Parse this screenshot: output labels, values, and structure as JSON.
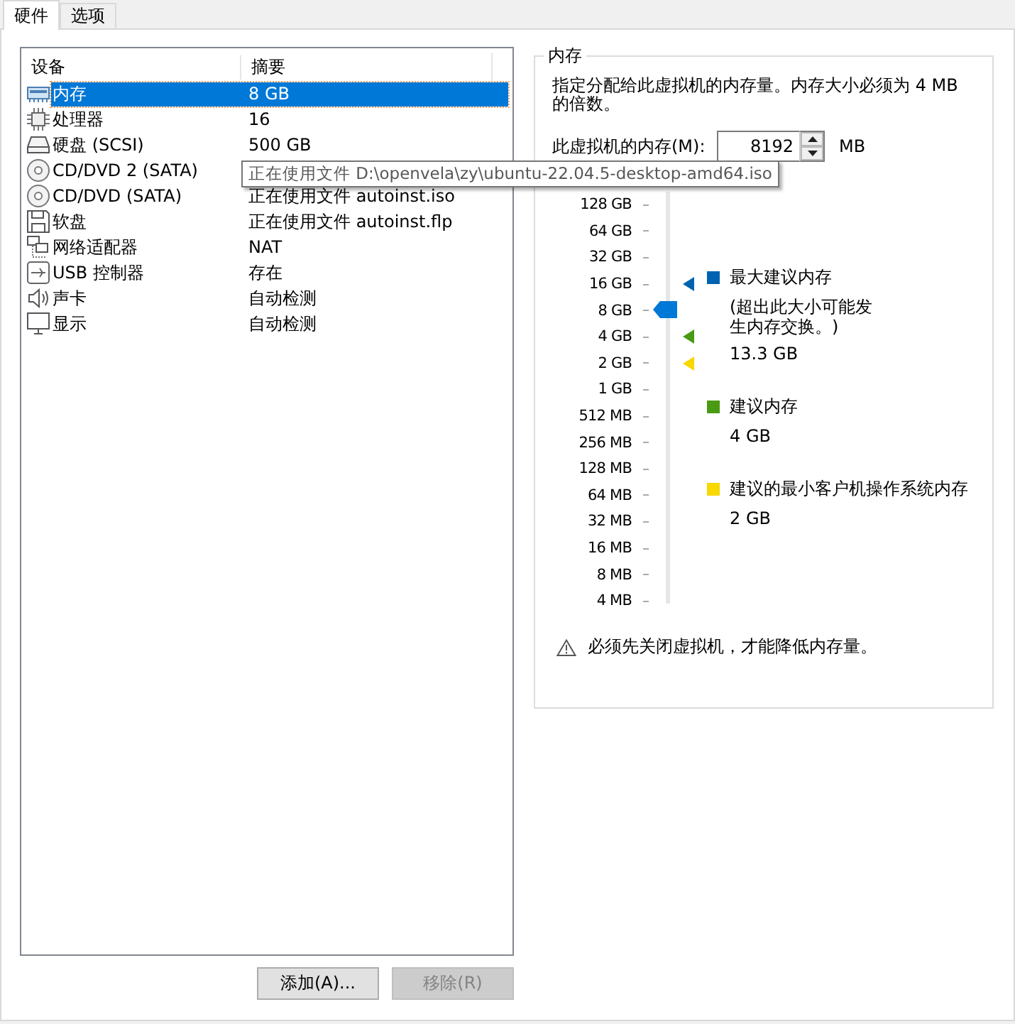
{
  "tabs": [
    {
      "label": "硬件",
      "selected": true
    },
    {
      "label": "选项",
      "selected": false
    }
  ],
  "devices": {
    "columns": [
      "设备",
      "摘要"
    ],
    "rows": [
      {
        "kind": "memory",
        "name": "内存",
        "summary": "8 GB",
        "selected": true
      },
      {
        "kind": "cpu",
        "name": "处理器",
        "summary": "16",
        "selected": false
      },
      {
        "kind": "disk",
        "name": "硬盘 (SCSI)",
        "summary": "500 GB",
        "selected": false
      },
      {
        "kind": "cd",
        "name": "CD/DVD 2 (SATA)",
        "selected": false
      },
      {
        "kind": "cd",
        "name": "CD/DVD (SATA)",
        "summary": "正在使用文件 autoinst.iso",
        "selected": false
      },
      {
        "kind": "floppy",
        "name": "软盘",
        "summary": "正在使用文件 autoinst.flp",
        "selected": false
      },
      {
        "kind": "network",
        "name": "网络适配器",
        "summary": "NAT",
        "selected": false
      },
      {
        "kind": "usb",
        "name": "USB 控制器",
        "summary": "存在",
        "selected": false
      },
      {
        "kind": "sound",
        "name": "声卡",
        "summary": "自动检测",
        "selected": false
      },
      {
        "kind": "display",
        "name": "显示",
        "summary": "自动检测",
        "selected": false
      }
    ]
  },
  "tooltip": "正在使用文件 D:\\openvela\\zy\\ubuntu-22.04.5-desktop-amd64.iso",
  "buttons": [
    {
      "label": "添加(A)...",
      "disabled": false
    },
    {
      "label": "移除(R)",
      "disabled": true
    }
  ],
  "memory": {
    "title": "内存",
    "description": "指定分配给此虚拟机的内存量。内存大小必须为 4 MB 的倍数。",
    "field_label": "此虚拟机的内存(M):",
    "value": "8192",
    "unit": "MB",
    "ticks": [
      {
        "label": "128 GB",
        "selected": false
      },
      {
        "label": "64 GB",
        "selected": false
      },
      {
        "label": "32 GB",
        "selected": false
      },
      {
        "label": "16 GB",
        "selected": false,
        "color": "#0063b1"
      },
      {
        "label": "8 GB",
        "selected": true
      },
      {
        "label": "4 GB",
        "selected": false,
        "color": "#4a9a14"
      },
      {
        "label": "2 GB",
        "selected": false,
        "color": "#f8d800"
      },
      {
        "label": "1 GB",
        "selected": false
      },
      {
        "label": "512 MB",
        "selected": false
      },
      {
        "label": "256 MB",
        "selected": false
      },
      {
        "label": "128 MB",
        "selected": false
      },
      {
        "label": "64 MB",
        "selected": false
      },
      {
        "label": "32 MB",
        "selected": false
      },
      {
        "label": "16 MB",
        "selected": false
      },
      {
        "label": "8 MB",
        "selected": false
      },
      {
        "label": "4 MB",
        "selected": false
      }
    ],
    "legend": [
      {
        "color": "#0063b1",
        "title": "最大建议内存",
        "note": "(超出此大小可能发生内存交换。)",
        "value": "13.3 GB"
      },
      {
        "color": "#4a9a14",
        "title": "建议内存",
        "value": "4 GB"
      },
      {
        "color": "#f8d800",
        "title": "建议的最小客户机操作系统内存",
        "value": "2 GB"
      }
    ],
    "warning": "必须先关闭虚拟机，才能降低内存量。"
  }
}
